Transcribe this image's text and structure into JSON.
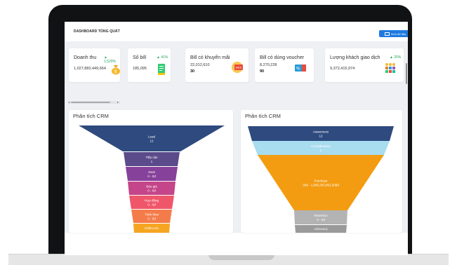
{
  "header": {
    "title": "DASHBOARD TỔNG QUÁT",
    "view_data_label": "Xem dữ liệu"
  },
  "kpis": [
    {
      "title": "Doanh thu",
      "growth": "1,520%",
      "value": "1,027,883,449,664",
      "icon": "money-bag-icon"
    },
    {
      "title": "Số bill",
      "growth": "41%",
      "value": "185,095",
      "icon": "bill-icon"
    },
    {
      "title": "Bill có khuyến mãi",
      "value": "22,012,610",
      "sub": "30",
      "icon": "sale-tag-icon"
    },
    {
      "title": "Bill có dùng voucher",
      "value": "8,270,228",
      "sub": "90",
      "icon": "voucher-icon"
    },
    {
      "title": "Lượng khách giao dịch",
      "growth": "25%",
      "value": "9,372,415,974",
      "icon": "customers-icon"
    }
  ],
  "panels": [
    {
      "title": "Phân tích CRM",
      "segments": [
        {
          "name": "Lead",
          "value": "12",
          "color": "#2e4a7e"
        },
        {
          "name": "Tiếp cận",
          "value": "1",
          "color": "#5b4b8a"
        },
        {
          "name": "Deal",
          "value": "0 - 0đ",
          "color": "#86419a"
        },
        {
          "name": "Báo giá",
          "value": "0 - 0đ",
          "color": "#c44589"
        },
        {
          "name": "Hợp đồng",
          "value": "0 - 0đ",
          "color": "#f0566a"
        },
        {
          "name": "Triển khai",
          "value": "0 - 0đ",
          "color": "#f47c4a"
        },
        {
          "name": "Chăm sóc",
          "value": "",
          "color": "#f6a521"
        }
      ]
    },
    {
      "title": "Phân tích CRM",
      "segments": [
        {
          "name": "Awareness",
          "value": "12",
          "color": "#2e4a7e"
        },
        {
          "name": "Consideration",
          "value": "2",
          "color": "#a8dcef"
        },
        {
          "name": "Purchase",
          "value": "309 - 1,000,303,861,508đ",
          "color": "#f39c12"
        },
        {
          "name": "Retention",
          "value": "0 - 0đ",
          "color": "#b3b3b3"
        },
        {
          "name": "Advocacy",
          "value": "",
          "color": "#9a9a9a"
        }
      ]
    }
  ]
}
